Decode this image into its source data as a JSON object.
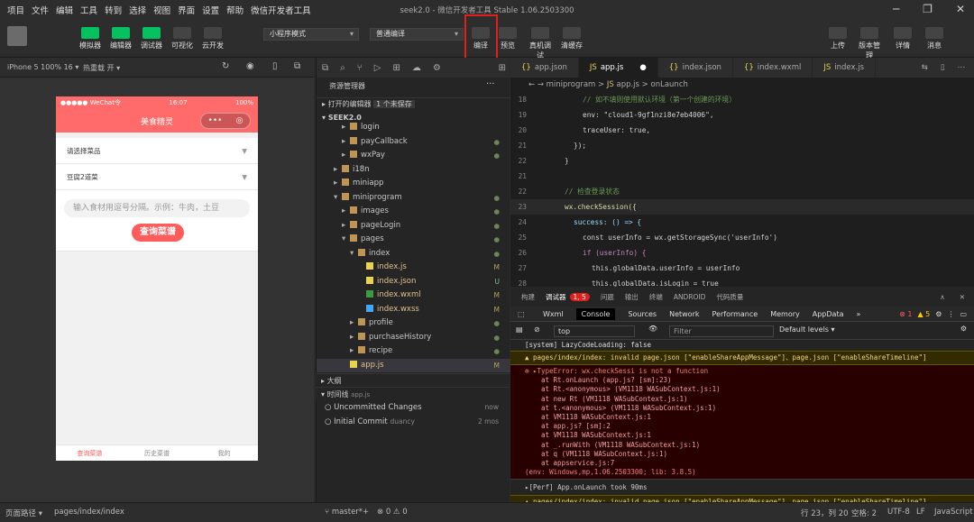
{
  "window": {
    "title": "seek2.0 - 微信开发者工具 Stable 1.06.2503300"
  },
  "menu": [
    "项目",
    "文件",
    "编辑",
    "工具",
    "转到",
    "选择",
    "视图",
    "界面",
    "设置",
    "帮助",
    "微信开发者工具"
  ],
  "toolbar": {
    "left": [
      {
        "label": "模拟器",
        "icon": "phone-icon"
      },
      {
        "label": "编辑器",
        "icon": "code-icon"
      },
      {
        "label": "调试器",
        "icon": "debug-icon"
      },
      {
        "label": "可视化",
        "icon": "layout-icon"
      },
      {
        "label": "云开发",
        "icon": "cloud-icon"
      }
    ],
    "mode_select": "小程序模式",
    "compile_select": "普通编译",
    "center": [
      {
        "label": "编译",
        "icon": "refresh-icon"
      },
      {
        "label": "预览",
        "icon": "eye-icon"
      },
      {
        "label": "真机调试",
        "icon": "debug-icon"
      },
      {
        "label": "清缓存",
        "icon": "database-icon"
      }
    ],
    "right": [
      {
        "label": "上传",
        "icon": "upload-icon"
      },
      {
        "label": "版本管理",
        "icon": "branch-icon"
      },
      {
        "label": "详情",
        "icon": "menu-icon"
      },
      {
        "label": "消息",
        "icon": "bell-icon"
      }
    ]
  },
  "simulator": {
    "device": "iPhone 5 100% 16 ▾",
    "hot_reload": "热重载 开 ▾",
    "status_left": "●●●●● WeChat令",
    "status_time": "16:07",
    "status_right": "100%",
    "nav_title": "美食精灵",
    "capsule_more": "•••",
    "capsule_close": "◎",
    "picker1": "请选择菜品",
    "picker2": "豆腐2道菜",
    "input_placeholder": "输入食材用逗号分隔。示例：牛肉，土豆",
    "query_button": "查询菜谱",
    "tabs": [
      "查询菜谱",
      "历史菜谱",
      "我的"
    ]
  },
  "explorer": {
    "header": "资源管理器",
    "open_editors": "打开的编辑器",
    "unsaved": "1 个未保存",
    "project": "SEEK2.0",
    "items": [
      {
        "name": "login",
        "depth": 2,
        "type": "folder",
        "mark": ""
      },
      {
        "name": "payCallback",
        "depth": 2,
        "type": "folder",
        "mark": "●"
      },
      {
        "name": "wxPay",
        "depth": 2,
        "type": "folder",
        "mark": "●"
      },
      {
        "name": "i18n",
        "depth": 1,
        "type": "folder",
        "mark": ""
      },
      {
        "name": "miniapp",
        "depth": 1,
        "type": "folder",
        "mark": ""
      },
      {
        "name": "miniprogram",
        "depth": 1,
        "type": "folder-open",
        "mark": "●"
      },
      {
        "name": "images",
        "depth": 2,
        "type": "folder",
        "mark": "●"
      },
      {
        "name": "pageLogin",
        "depth": 2,
        "type": "folder",
        "mark": "●"
      },
      {
        "name": "pages",
        "depth": 2,
        "type": "folder-open",
        "mark": "●"
      },
      {
        "name": "index",
        "depth": 3,
        "type": "folder-open",
        "mark": "●"
      },
      {
        "name": "index.js",
        "depth": 4,
        "type": "js",
        "mark": "M"
      },
      {
        "name": "index.json",
        "depth": 4,
        "type": "json",
        "mark": "U"
      },
      {
        "name": "index.wxml",
        "depth": 4,
        "type": "wxml",
        "mark": "M"
      },
      {
        "name": "index.wxss",
        "depth": 4,
        "type": "wxss",
        "mark": "M"
      },
      {
        "name": "profile",
        "depth": 3,
        "type": "folder",
        "mark": "●"
      },
      {
        "name": "purchaseHistory",
        "depth": 3,
        "type": "folder",
        "mark": "●"
      },
      {
        "name": "recipe",
        "depth": 3,
        "type": "folder",
        "mark": "●"
      },
      {
        "name": "app.js",
        "depth": 2,
        "type": "js",
        "mark": "M"
      }
    ],
    "outline": "大纲",
    "timeline": "时间线",
    "timeline_file": "app.js",
    "commits": [
      {
        "msg": "Uncommitted Changes",
        "time": "now"
      },
      {
        "msg": "Initial Commit",
        "author": "duancy",
        "time": "2 mos"
      }
    ]
  },
  "editor": {
    "tabs": [
      "app.json",
      "app.js",
      "index.json",
      "index.wxml",
      "index.js"
    ],
    "breadcrumb": [
      "miniprogram",
      "app.js",
      "onLaunch"
    ],
    "lines": [
      {
        "n": "18",
        "t": "//   如不填则使用默认环境（第一个创建的环境）",
        "c": "#6a9955",
        "i": 3
      },
      {
        "n": "19",
        "t": "env: \"cloud1-9gf1nzi8e7eb4006\",",
        "c": "#d4d4d4",
        "i": 3
      },
      {
        "n": "20",
        "t": "traceUser: true,",
        "c": "#d4d4d4",
        "i": 3
      },
      {
        "n": "21",
        "t": "});",
        "c": "#d4d4d4",
        "i": 2
      },
      {
        "n": "22",
        "t": "}",
        "c": "#d4d4d4",
        "i": 1
      },
      {
        "n": "21",
        "t": "",
        "c": "#d4d4d4",
        "i": 0
      },
      {
        "n": "22",
        "t": "// 检查登录状态",
        "c": "#6a9955",
        "i": 1
      },
      {
        "n": "23",
        "t": "wx.checkSession({",
        "c": "#dcdcaa",
        "i": 1
      },
      {
        "n": "24",
        "t": "success: () => {",
        "c": "#9cdcfe",
        "i": 2
      },
      {
        "n": "25",
        "t": "const userInfo = wx.getStorageSync('userInfo')",
        "c": "#d4d4d4",
        "i": 3
      },
      {
        "n": "26",
        "t": "if (userInfo) {",
        "c": "#c586c0",
        "i": 3
      },
      {
        "n": "27",
        "t": "this.globalData.userInfo = userInfo",
        "c": "#d4d4d4",
        "i": 4
      },
      {
        "n": "28",
        "t": "this.globalData.isLogin = true",
        "c": "#d4d4d4",
        "i": 4
      }
    ]
  },
  "panel": {
    "tabs": [
      "构建",
      "调试器",
      "问题",
      "输出",
      "终端",
      "ANDROID",
      "代码质量"
    ],
    "badge": "1, 5"
  },
  "devtools": {
    "tabs": [
      "Wxml",
      "Console",
      "Sources",
      "Network",
      "Performance",
      "Memory",
      "AppData"
    ],
    "errors": "1",
    "warnings": "5",
    "context": "top",
    "filter_placeholder": "Filter",
    "levels": "Default levels ▾"
  },
  "console": [
    {
      "type": "log",
      "text": "[system] LazyCodeLoading: false"
    },
    {
      "type": "warn",
      "text": "▲ pages/index/index: invalid page.json [\"enableShareAppMessage\"]、page.json [\"enableShareTimeline\"]"
    },
    {
      "type": "err",
      "text": "⊗ ▸TypeError: wx.checkSessi is not a function"
    },
    {
      "type": "trace",
      "text": "at Rt.onLaunch (app.js? [sm]:23)"
    },
    {
      "type": "trace",
      "text": "at Rt.<anonymous> (VM1118 WASubContext.js:1)"
    },
    {
      "type": "trace",
      "text": "at new Rt (VM1118 WASubContext.js:1)"
    },
    {
      "type": "trace",
      "text": "at t.<anonymous> (VM1118 WASubContext.js:1)"
    },
    {
      "type": "trace",
      "text": "at VM1118 WASubContext.js:1"
    },
    {
      "type": "trace",
      "text": "at app.js? [sm]:2"
    },
    {
      "type": "trace",
      "text": "at VM1118 WASubContext.js:1"
    },
    {
      "type": "trace",
      "text": "at _.runWith (VM1118 WASubContext.js:1)"
    },
    {
      "type": "trace",
      "text": "at q (VM1118 WASubContext.js:1)"
    },
    {
      "type": "trace",
      "text": "at appservice.js:7"
    },
    {
      "type": "errfoot",
      "text": "(env: Windows,mp,1.06.2503300; lib: 3.8.5)"
    },
    {
      "type": "perf",
      "text": "▸[Perf] App.onLaunch took 90ms"
    },
    {
      "type": "warn",
      "text": "▲ pages/index/index: invalid page.json [\"enableShareAppMessage\"]、page.json [\"enableShareTimeline\"]"
    }
  ],
  "statusbar": {
    "page_path_label": "页面路径 ▾",
    "page_path": "pages/index/index",
    "branch": "master*+",
    "problems": "⊗ 0 ⚠ 0",
    "position": "行 23，列 20",
    "spaces": "空格: 2",
    "encoding": "UTF-8",
    "eol": "LF",
    "language": "JavaScript"
  },
  "colors": {
    "accent": "#07c160",
    "highlight": "#e0201c",
    "brand": "#ff6b6b"
  }
}
